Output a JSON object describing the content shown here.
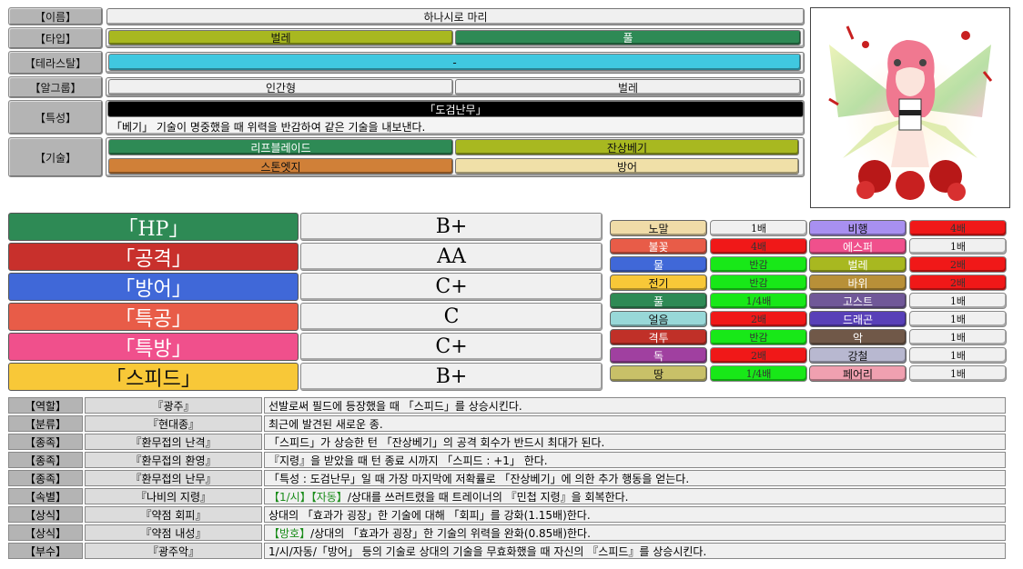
{
  "labels": {
    "name": "【이름】",
    "type": "【타입】",
    "tera": "【테라스탈】",
    "egg": "【알그룹】",
    "ability": "【특성】",
    "moves": "【기술】"
  },
  "name": "하나시로 마리",
  "types": [
    {
      "label": "벌레",
      "color": "#a8b820"
    },
    {
      "label": "풀",
      "color": "#2e8a55"
    }
  ],
  "tera": {
    "label": "-",
    "color": "#40c8e0"
  },
  "egg_groups": [
    "인간형",
    "벌레"
  ],
  "ability": {
    "name": "「도검난무」",
    "desc": "「베기」 기술이 명중했을 때 위력을 반감하여 같은 기술을 내보낸다."
  },
  "moves": [
    {
      "label": "리프블레이드",
      "color": "#2e8a55"
    },
    {
      "label": "잔상베기",
      "color": "#a8b820"
    },
    {
      "label": "스톤엣지",
      "color": "#d08038"
    },
    {
      "label": "방어",
      "color": "#f0e0a8"
    }
  ],
  "stats": [
    {
      "name": "「HP」",
      "grade": "B+",
      "color": "#2e8a55"
    },
    {
      "name": "「공격」",
      "grade": "AA",
      "color": "#c8302c"
    },
    {
      "name": "「방어」",
      "grade": "C+",
      "color": "#4068d8"
    },
    {
      "name": "「특공」",
      "grade": "C",
      "color": "#e85c48"
    },
    {
      "name": "「특방」",
      "grade": "C+",
      "color": "#f0508c"
    },
    {
      "name": "「스피드」",
      "grade": "B+",
      "color": "#f8c838"
    }
  ],
  "type_chart": [
    {
      "type": "노말",
      "tcolor": "#f0dca8",
      "mult": "1배",
      "mcolor": "#f0f0f0"
    },
    {
      "type": "비행",
      "tcolor": "#a890f0",
      "mult": "4배",
      "mcolor": "#f01818"
    },
    {
      "type": "불꽃",
      "tcolor": "#e85c48",
      "mult": "4배",
      "mcolor": "#f01818"
    },
    {
      "type": "에스퍼",
      "tcolor": "#f0508c",
      "mult": "1배",
      "mcolor": "#f0f0f0"
    },
    {
      "type": "물",
      "tcolor": "#4068d8",
      "mult": "반감",
      "mcolor": "#18e818"
    },
    {
      "type": "벌레",
      "tcolor": "#a8b820",
      "mult": "2배",
      "mcolor": "#f01818"
    },
    {
      "type": "전기",
      "tcolor": "#f8c838",
      "mult": "반감",
      "mcolor": "#18e818"
    },
    {
      "type": "바위",
      "tcolor": "#b89038",
      "mult": "2배",
      "mcolor": "#f01818"
    },
    {
      "type": "풀",
      "tcolor": "#2e8a55",
      "mult": "1/4배",
      "mcolor": "#18e818"
    },
    {
      "type": "고스트",
      "tcolor": "#705898",
      "mult": "1배",
      "mcolor": "#f0f0f0"
    },
    {
      "type": "얼음",
      "tcolor": "#98d8d8",
      "mult": "2배",
      "mcolor": "#f01818"
    },
    {
      "type": "드래곤",
      "tcolor": "#5840b8",
      "mult": "1배",
      "mcolor": "#f0f0f0"
    },
    {
      "type": "격투",
      "tcolor": "#c03028",
      "mult": "반감",
      "mcolor": "#18e818"
    },
    {
      "type": "악",
      "tcolor": "#705848",
      "mult": "1배",
      "mcolor": "#f0f0f0"
    },
    {
      "type": "독",
      "tcolor": "#a040a0",
      "mult": "2배",
      "mcolor": "#f01818"
    },
    {
      "type": "강철",
      "tcolor": "#b8b8d0",
      "mult": "1배",
      "mcolor": "#f0f0f0"
    },
    {
      "type": "땅",
      "tcolor": "#c8c068",
      "mult": "1/4배",
      "mcolor": "#18e818"
    },
    {
      "type": "페어리",
      "tcolor": "#f0a0b0",
      "mult": "1배",
      "mcolor": "#f0f0f0"
    }
  ],
  "traits": [
    {
      "label": "【역할】",
      "name": "『광주』",
      "pre": "",
      "desc": "선발로써 필드에 등장했을 때 「스피드」를 상승시킨다."
    },
    {
      "label": "【분류】",
      "name": "『현대종』",
      "pre": "",
      "desc": "최근에 발견된 새로운 종."
    },
    {
      "label": "【종족】",
      "name": "『환무접의 난격』",
      "pre": "",
      "desc": "「스피드」가 상승한 턴 「잔상베기」의 공격 회수가 반드시 최대가 된다."
    },
    {
      "label": "【종족】",
      "name": "『환무접의 환영』",
      "pre": "",
      "desc": "『지령』을 받았을 때 턴 종료 시까지 「스피드 : +1」 한다."
    },
    {
      "label": "【종족】",
      "name": "『환무접의 난무』",
      "pre": "",
      "desc": "「특성 : 도검난무」일 때 가장 마지막에 저확률로 「잔상베기」에 의한 추가 행동을 얻는다."
    },
    {
      "label": "【속별】",
      "name": "『나비의 지령』",
      "pre": "【1/시】【자동】",
      "desc": "/상대를 쓰러트렸을 때 트레이너의 『민첩 지령』을 회복한다."
    },
    {
      "label": "【상식】",
      "name": "『약점 회피』",
      "pre": "",
      "desc": "상대의 「효과가 굉장」한 기술에 대해 「회피」를 강화(1.15배)한다."
    },
    {
      "label": "【상식】",
      "name": "『약점 내성』",
      "pre": "【방호】",
      "desc": "/상대의 「효과가 굉장」한 기술의 위력을 완화(0.85배)한다."
    },
    {
      "label": "【부수】",
      "name": "『광주악』",
      "pre": "",
      "desc": "1/시/자동/「방어」 등의 기술로 상대의 기술을 무효화했을 때 자신의 『스피드』를 상승시킨다."
    }
  ]
}
